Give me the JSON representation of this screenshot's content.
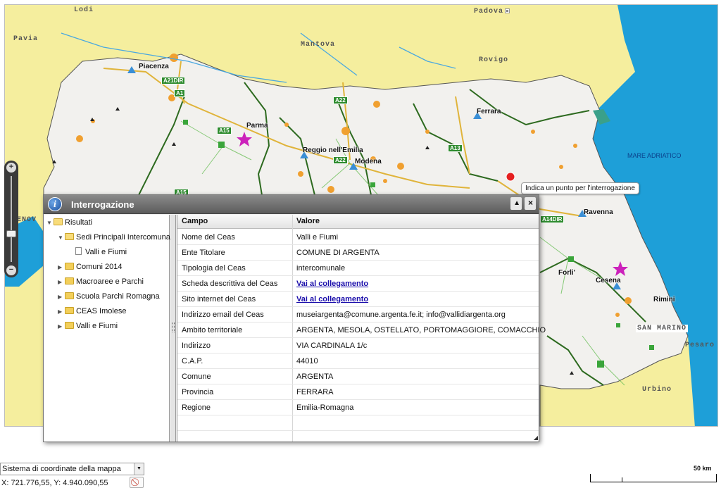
{
  "map": {
    "outer_cities": [
      {
        "name": "Lodi"
      },
      {
        "name": "Padova"
      },
      {
        "name": "Pavia"
      },
      {
        "name": "Mantova"
      },
      {
        "name": "Rovigo"
      },
      {
        "name": "Urbino"
      },
      {
        "name": "Pesaro"
      },
      {
        "name": "SAN MARINO"
      },
      {
        "name": "GENOV"
      }
    ],
    "region_cities": [
      {
        "name": "Piacenza"
      },
      {
        "name": "Parma"
      },
      {
        "name": "Reggio nell'Emilia"
      },
      {
        "name": "Modena"
      },
      {
        "name": "Ferrara"
      },
      {
        "name": "Ravenna"
      },
      {
        "name": "Forli'"
      },
      {
        "name": "Cesena"
      },
      {
        "name": "Rimini"
      }
    ],
    "sea_label": "MARE ADRIATICO",
    "road_signs": [
      "A21DIR",
      "A1",
      "A22",
      "A15",
      "A22",
      "A13",
      "A15",
      "A14DIR"
    ],
    "tooltip": "Indica un punto per l'interrogazione",
    "zoom": {
      "plus": "+",
      "minus": "−"
    }
  },
  "dialog": {
    "title": "Interrogazione",
    "info_icon": "i",
    "collapse_icon": "▲",
    "close_icon": "×",
    "tree": [
      {
        "label": "Risultati",
        "toggle": "▼",
        "icon": "folder-open"
      },
      {
        "label": "Sedi Principali Intercomunali",
        "toggle": "▼",
        "icon": "folder-open"
      },
      {
        "label": "Valli e Fiumi",
        "toggle": "",
        "icon": "document"
      },
      {
        "label": "Comuni 2014",
        "toggle": "▶",
        "icon": "folder"
      },
      {
        "label": "Macroaree e Parchi",
        "toggle": "▶",
        "icon": "folder"
      },
      {
        "label": "Scuola Parchi Romagna",
        "toggle": "▶",
        "icon": "folder"
      },
      {
        "label": "CEAS Imolese",
        "toggle": "▶",
        "icon": "folder"
      },
      {
        "label": "Valli e Fiumi",
        "toggle": "▶",
        "icon": "folder"
      }
    ],
    "grid": {
      "headers": [
        "Campo",
        "Valore"
      ],
      "rows": [
        {
          "field": "Nome del Ceas",
          "value": "Valli e Fiumi"
        },
        {
          "field": "Ente Titolare",
          "value": "COMUNE DI ARGENTA"
        },
        {
          "field": "Tipologia del Ceas",
          "value": "intercomunale"
        },
        {
          "field": "Scheda descrittiva del Ceas",
          "value": "Vai al collegamento"
        },
        {
          "field": "Sito internet del Ceas",
          "value": "Vai al collegamento"
        },
        {
          "field": "Indirizzo email del Ceas",
          "value": "museiargenta@comune.argenta.fe.it; info@vallidiargenta.org"
        },
        {
          "field": "Ambito territoriale",
          "value": "ARGENTA, MESOLA, OSTELLATO, PORTOMAGGIORE, COMACCHIO"
        },
        {
          "field": "Indirizzo",
          "value": "VIA CARDINALA 1/c"
        },
        {
          "field": "C.A.P.",
          "value": "44010"
        },
        {
          "field": "Comune",
          "value": "ARGENTA"
        },
        {
          "field": "Provincia",
          "value": "FERRARA"
        },
        {
          "field": "Regione",
          "value": "Emilia-Romagna"
        },
        {
          "field": "",
          "value": ""
        }
      ]
    },
    "resize_grip": "◢"
  },
  "footer": {
    "crs_select": "Sistema di coordinate della mappa",
    "crs_arrow": "▼",
    "coords": "X: 721.776,55, Y: 4.940.090,55",
    "scale_label": "50 km"
  },
  "colors": {
    "land_outside": "#f5ee9e",
    "region_land": "#f2f1ee",
    "sea": "#1e9fd8",
    "boundary": "#2d6a1f",
    "dialog_title": "#6a6a6a",
    "link": "#1a0dab"
  }
}
